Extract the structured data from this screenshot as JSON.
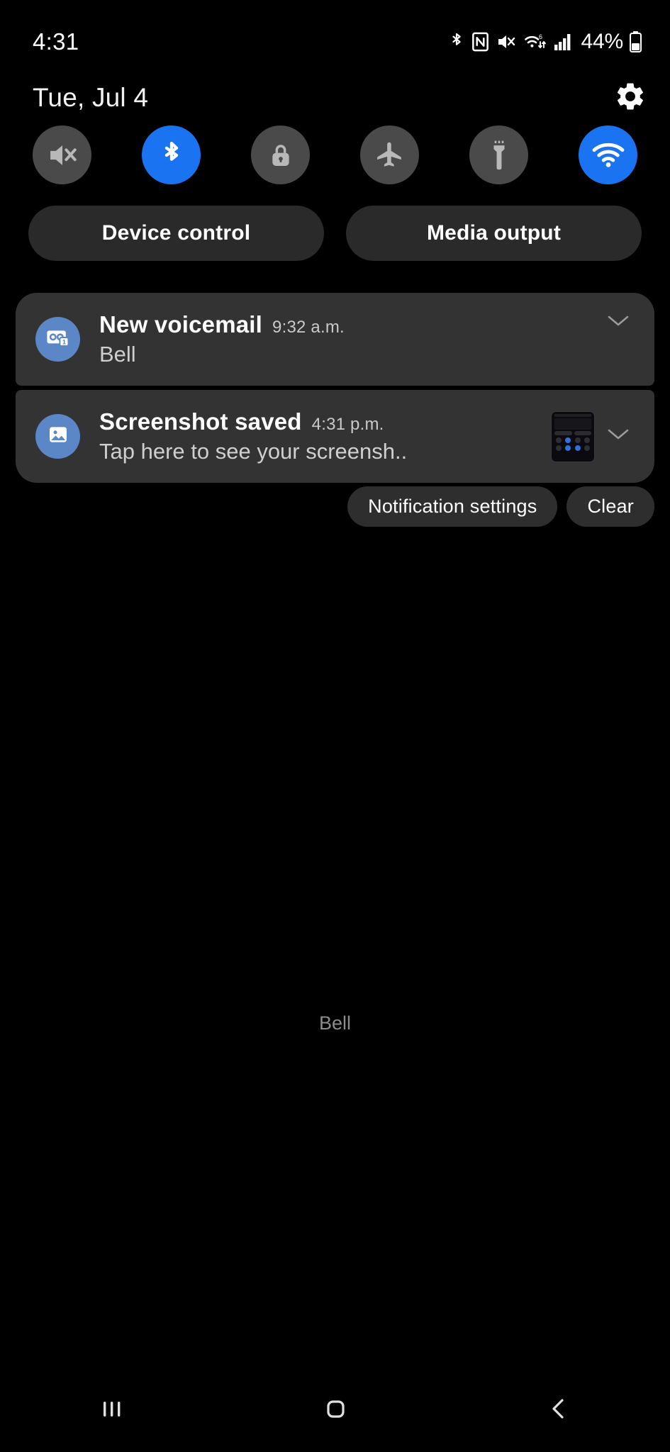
{
  "status_bar": {
    "time": "4:31",
    "battery_percent": "44%",
    "icons": [
      "bluetooth-icon",
      "nfc-icon",
      "mute-icon",
      "wifi-6-icon",
      "cellular-signal-icon",
      "battery-icon"
    ]
  },
  "header": {
    "date": "Tue, Jul 4",
    "settings_icon": "gear-icon"
  },
  "quick_toggles": [
    {
      "name": "sound-mute-toggle",
      "icon": "volume-mute-icon",
      "active": false
    },
    {
      "name": "bluetooth-toggle",
      "icon": "bluetooth-icon",
      "active": true
    },
    {
      "name": "auto-rotate-toggle",
      "icon": "lock-icon",
      "active": false
    },
    {
      "name": "airplane-mode-toggle",
      "icon": "airplane-icon",
      "active": false
    },
    {
      "name": "flashlight-toggle",
      "icon": "flashlight-icon",
      "active": false
    },
    {
      "name": "wifi-toggle",
      "icon": "wifi-icon",
      "active": true
    }
  ],
  "pills": {
    "device_control": "Device control",
    "media_output": "Media output"
  },
  "notifications": [
    {
      "id": "voicemail",
      "icon": "voicemail-icon",
      "title": "New voicemail",
      "time": "9:32 a.m.",
      "text": "Bell",
      "has_thumbnail": false,
      "expand_icon": "chevron-down-icon"
    },
    {
      "id": "screenshot",
      "icon": "image-icon",
      "title": "Screenshot saved",
      "time": "4:31 p.m.",
      "text": "Tap here to see your screensh..",
      "has_thumbnail": true,
      "expand_icon": "chevron-down-icon"
    }
  ],
  "actions": {
    "notification_settings": "Notification settings",
    "clear": "Clear"
  },
  "carrier": "Bell",
  "nav_bar": {
    "recents": "recents-icon",
    "home": "home-icon",
    "back": "back-icon"
  },
  "colors": {
    "accent_blue": "#1a73f0",
    "notif_bg": "#333333",
    "toggle_off": "#4a4a4a",
    "avatar_blue": "#5b87c7",
    "background": "#000000"
  }
}
